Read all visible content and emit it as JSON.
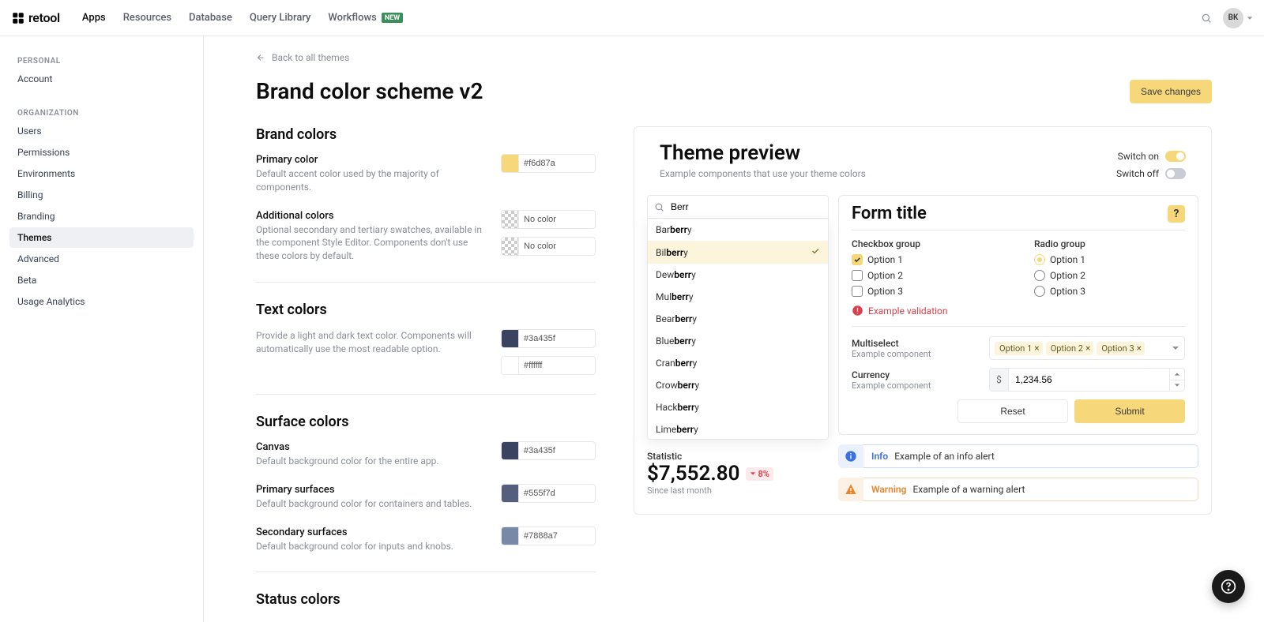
{
  "brand": {
    "name": "retool"
  },
  "nav": {
    "apps": "Apps",
    "resources": "Resources",
    "database": "Database",
    "query_library": "Query Library",
    "workflows": "Workflows",
    "workflows_badge": "New"
  },
  "user": {
    "initials": "BK"
  },
  "sidebar": {
    "personal_label": "Personal",
    "org_label": "Organization",
    "items": {
      "account": "Account",
      "users": "Users",
      "permissions": "Permissions",
      "environments": "Environments",
      "billing": "Billing",
      "branding": "Branding",
      "themes": "Themes",
      "advanced": "Advanced",
      "beta": "Beta",
      "usage": "Usage Analytics"
    }
  },
  "back_link": "Back to all themes",
  "page_title": "Brand color scheme v2",
  "save_button": "Save changes",
  "sections": {
    "brand_colors": "Brand colors",
    "text_colors": "Text colors",
    "surface_colors": "Surface colors",
    "status_colors": "Status colors"
  },
  "settings": {
    "primary_color": {
      "label": "Primary color",
      "desc": "Default accent color used by the majority of components.",
      "value": "#f6d87a"
    },
    "additional_colors": {
      "label": "Additional colors",
      "desc": "Optional secondary and tertiary swatches, available in the component Style Editor. Components don't use these colors by default.",
      "value1": "No color",
      "value2": "No color"
    },
    "text_colors_desc": "Provide a light and dark text color. Components will automatically use the most readable option.",
    "text_dark": "#3a435f",
    "text_light": "#ffffff",
    "canvas": {
      "label": "Canvas",
      "desc": "Default background color for the entire app.",
      "value": "#3a435f"
    },
    "primary_surfaces": {
      "label": "Primary surfaces",
      "desc": "Default background color for containers and tables.",
      "value": "#555f7d"
    },
    "secondary_surfaces": {
      "label": "Secondary surfaces",
      "desc": "Default background color for inputs and knobs.",
      "value": "#7888a7"
    }
  },
  "preview": {
    "title": "Theme preview",
    "subtitle": "Example components that use your theme colors",
    "switch_on_label": "Switch on",
    "switch_off_label": "Switch off",
    "search_value": "Berr",
    "dropdown": [
      {
        "prefix": "Bar",
        "match": "berr",
        "suffix": "y",
        "selected": false
      },
      {
        "prefix": "Bil",
        "match": "berr",
        "suffix": "y",
        "selected": true
      },
      {
        "prefix": "Dew",
        "match": "berr",
        "suffix": "y",
        "selected": false
      },
      {
        "prefix": "Mul",
        "match": "berr",
        "suffix": "y",
        "selected": false
      },
      {
        "prefix": "Bear",
        "match": "berr",
        "suffix": "y",
        "selected": false
      },
      {
        "prefix": "Blue",
        "match": "berr",
        "suffix": "y",
        "selected": false
      },
      {
        "prefix": "Cran",
        "match": "berr",
        "suffix": "y",
        "selected": false
      },
      {
        "prefix": "Crow",
        "match": "berr",
        "suffix": "y",
        "selected": false
      },
      {
        "prefix": "Hack",
        "match": "berr",
        "suffix": "y",
        "selected": false
      },
      {
        "prefix": "Lime",
        "match": "berr",
        "suffix": "y",
        "selected": false
      }
    ],
    "statistic": {
      "label": "Statistic",
      "value": "$7,552.80",
      "delta": "8%",
      "caption": "Since last month"
    },
    "form": {
      "title": "Form title",
      "checkbox_group": "Checkbox group",
      "radio_group": "Radio group",
      "option1": "Option 1",
      "option2": "Option 2",
      "option3": "Option 3",
      "validation": "Example validation",
      "multiselect_label": "Multiselect",
      "example_component": "Example component",
      "currency_label": "Currency",
      "currency_prefix": "$",
      "currency_value": "1,234.56",
      "tags": [
        "Option 1",
        "Option 2",
        "Option 3"
      ],
      "reset": "Reset",
      "submit": "Submit"
    },
    "alerts": {
      "info_title": "Info",
      "info_body": "Example of an info alert",
      "warning_title": "Warning",
      "warning_body": "Example of a warning alert"
    }
  }
}
